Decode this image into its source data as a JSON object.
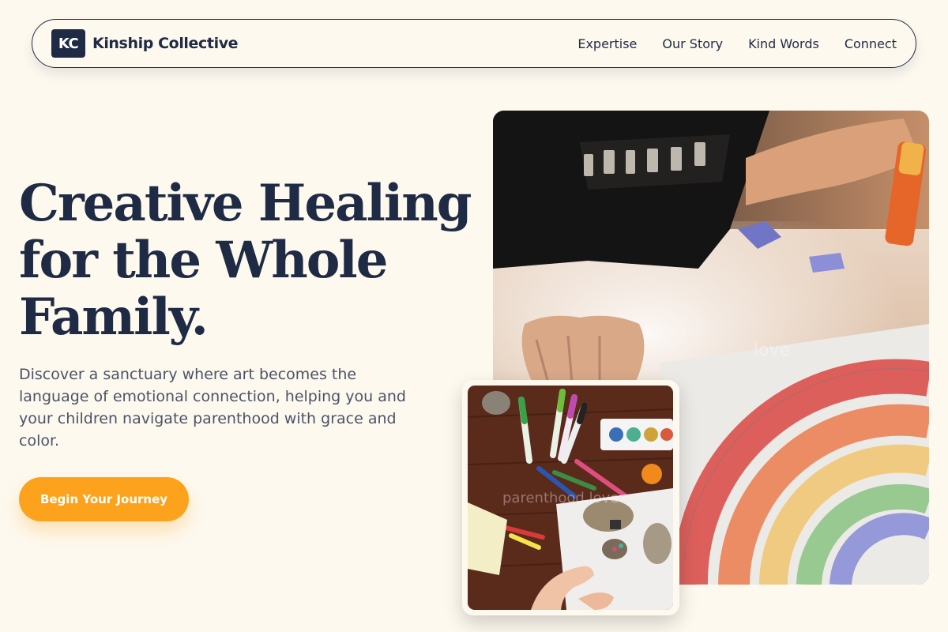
{
  "nav": {
    "logo_mark": "KC",
    "brand_name": "Kinship Collective",
    "links": [
      {
        "label": "Expertise"
      },
      {
        "label": "Our Story"
      },
      {
        "label": "Kind Words"
      },
      {
        "label": "Connect"
      }
    ]
  },
  "hero": {
    "headline_lines": [
      "Creative Healing",
      "for the Whole",
      "Family."
    ],
    "lead": "Discover a sanctuary where art becomes the language of emotional connection, helping you and your children navigate parenthood with grace and color.",
    "cta_label": "Begin Your Journey"
  },
  "images": {
    "main_photo": {
      "watermark": "love"
    },
    "inset_photo": {
      "watermark": "parenthood.love"
    }
  },
  "colors": {
    "background": "#fdf9ef",
    "navy": "#1f2a44",
    "accent": "#fda21c",
    "body_text": "#4b5366"
  }
}
